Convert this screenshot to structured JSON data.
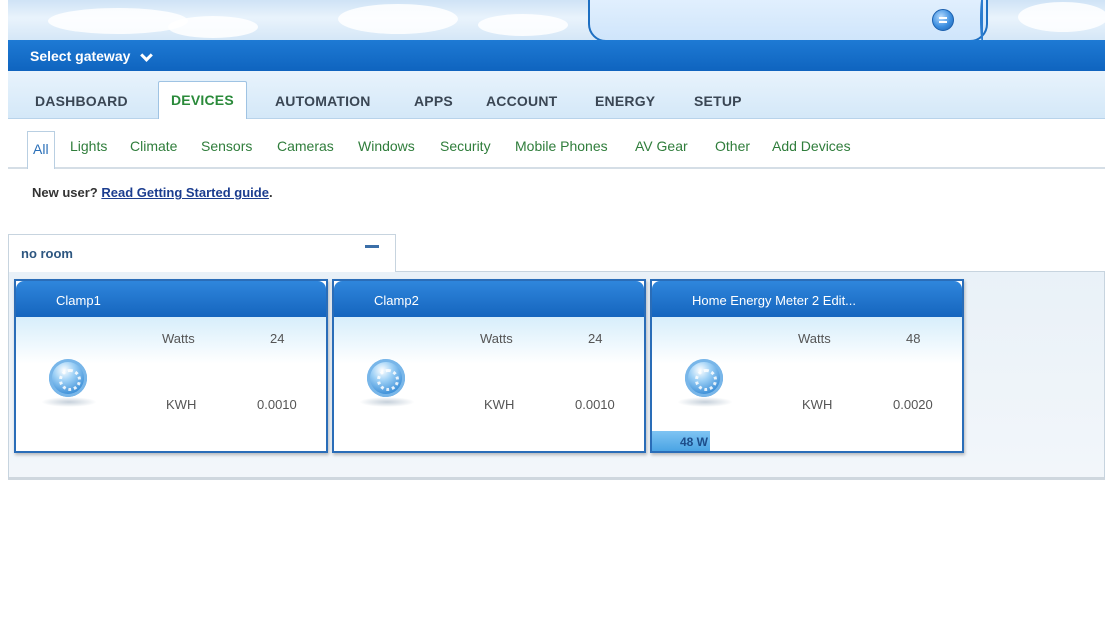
{
  "gateway": {
    "label": "Select gateway"
  },
  "main_nav": {
    "tabs": [
      {
        "label": "DASHBOARD",
        "active": false
      },
      {
        "label": "DEVICES",
        "active": true
      },
      {
        "label": "AUTOMATION",
        "active": false
      },
      {
        "label": "APPS",
        "active": false
      },
      {
        "label": "ACCOUNT",
        "active": false
      },
      {
        "label": "ENERGY",
        "active": false
      },
      {
        "label": "SETUP",
        "active": false
      }
    ]
  },
  "sub_nav": {
    "tabs": [
      {
        "label": "All",
        "active": true
      },
      {
        "label": "Lights"
      },
      {
        "label": "Climate"
      },
      {
        "label": "Sensors"
      },
      {
        "label": "Cameras"
      },
      {
        "label": "Windows"
      },
      {
        "label": "Security"
      },
      {
        "label": "Mobile Phones"
      },
      {
        "label": "AV Gear"
      },
      {
        "label": "Other"
      },
      {
        "label": "Add Devices"
      }
    ]
  },
  "new_user": {
    "prefix": "New user?",
    "link": "Read Getting Started guide",
    "suffix": "."
  },
  "room": {
    "name": "no room"
  },
  "devices": [
    {
      "name": "Clamp1",
      "watts_label": "Watts",
      "watts": "24",
      "kwh_label": "KWH",
      "kwh": "0.0010"
    },
    {
      "name": "Clamp2",
      "watts_label": "Watts",
      "watts": "24",
      "kwh_label": "KWH",
      "kwh": "0.0010"
    },
    {
      "name": "Home Energy Meter 2 Edit...",
      "watts_label": "Watts",
      "watts": "48",
      "kwh_label": "KWH",
      "kwh": "0.0020",
      "badge": "48 W"
    }
  ],
  "colors": {
    "accent_blue": "#1565be",
    "nav_green": "#2f7d3b",
    "active_tab_green": "#2a8a3a"
  },
  "icons": {
    "menu": "menu-circle-icon",
    "dropdown": "chevron-down-icon",
    "device": "meter-gear-icon",
    "collapse": "minus-icon"
  }
}
